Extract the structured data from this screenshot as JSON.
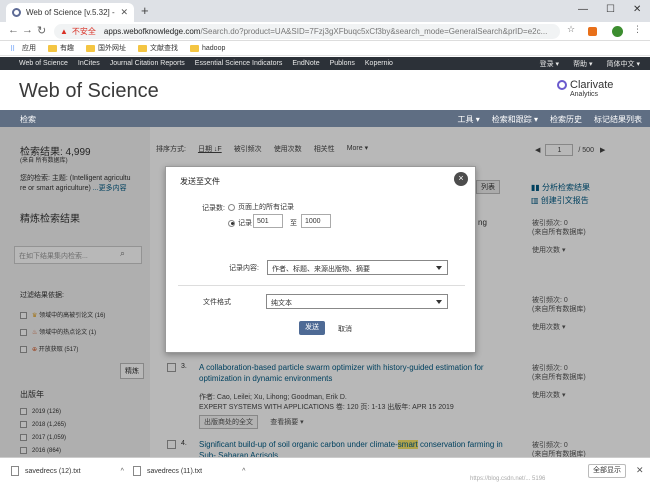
{
  "browser": {
    "tab_title": "Web of Science [v.5.32] - 所有数",
    "insecure_label": "不安全",
    "url_host": "apps.webofknowledge.com",
    "url_path": "/Search.do?product=UA&SID=7Fzj3gXFbuqc5xCf3by&search_mode=GeneralSearch&prID=e2c...",
    "bookmarks": [
      "应用",
      "有趣",
      "国外网址",
      "文献查找",
      "hadoop"
    ]
  },
  "wos_nav": {
    "links": [
      "Web of Science",
      "InCites",
      "Journal Citation Reports",
      "Essential Science Indicators",
      "EndNote",
      "Publons",
      "Kopernio"
    ],
    "right": [
      "登录 ▾",
      "帮助 ▾",
      "简体中文 ▾"
    ]
  },
  "header": {
    "title": "Web of Science",
    "brand": "Clarivate",
    "brand_sub": "Analytics"
  },
  "searchbar": {
    "left": "检索",
    "right": [
      "工具 ▾",
      "检索和跟踪 ▾",
      "检索历史",
      "标记结果列表"
    ]
  },
  "sidebar": {
    "results_label": "检索结果: 4,999",
    "results_sub": "(来自 所有数据库)",
    "query_line1": "您的检索: 主题: (Intelligent agricultu",
    "query_line2": "re or smart agriculture)",
    "more": "...更多内容",
    "refine_title": "精炼检索结果",
    "filter_placeholder": "在如下结果集内检索...",
    "filter_by": "过滤结果依据:",
    "filters": [
      "领域中的高被引论文 (16)",
      "领域中的热点论文 (1)",
      "开放获取 (517)"
    ],
    "refine_button": "精炼",
    "pub_year_title": "出版年",
    "years": [
      "2019 (126)",
      "2018 (1,265)",
      "2017 (1,059)",
      "2016 (864)"
    ]
  },
  "main": {
    "sort_label": "排序方式:",
    "sort_options": [
      "日期 ↓F",
      "被引频次",
      "使用次数",
      "相关性",
      "More ▾"
    ],
    "page_current": "1",
    "page_total": "/ 500",
    "analysis_link": "分析检索结果",
    "citation_report_link": "创建引文报告",
    "list_btn": "列表",
    "result1_title_tail": "ng",
    "cited_label": "被引频次: 0",
    "cited_sub": "(来自所有数据库)",
    "usage_label": "使用次数 ▾",
    "result3_num": "3.",
    "result3_title": "A collaboration-based particle swarm optimizer with history-guided estimation for optimization in dynamic environments",
    "result3_authors": "作者: Cao, Leilei; Xu, Lihong; Goodman, Erik D.",
    "result3_journal": "EXPERT SYSTEMS WITH APPLICATIONS  卷: 120  页: 1-13  出版年: APR 15 2019",
    "fulltext_btn": "出版商处的全文",
    "abstract_btn": "查看摘要 ▾",
    "result4_num": "4.",
    "result4_title_a": "Significant build-up of soil organic carbon under climate-",
    "result4_title_hl": "smart",
    "result4_title_b": " conservation farming in Sub-",
    "result4_title_c": "Saharan Acrisols"
  },
  "dialog": {
    "title": "发送至文件",
    "close": "×",
    "records_label": "记录数:",
    "opt_all": "页面上的所有记录",
    "opt_range": "记录",
    "range_from": "501",
    "range_to_label": "至",
    "range_to": "1000",
    "content_label": "记录内容:",
    "content_value": "作者、标题、来源出版物、摘要",
    "format_label": "文件格式",
    "format_value": "纯文本",
    "send": "发送",
    "cancel": "取消"
  },
  "downloads": {
    "items": [
      "savedrecs (12).txt",
      "savedrecs (11).txt"
    ],
    "show_all": "全部显示",
    "watermark": "https://blog.csdn.net/... 5196"
  }
}
